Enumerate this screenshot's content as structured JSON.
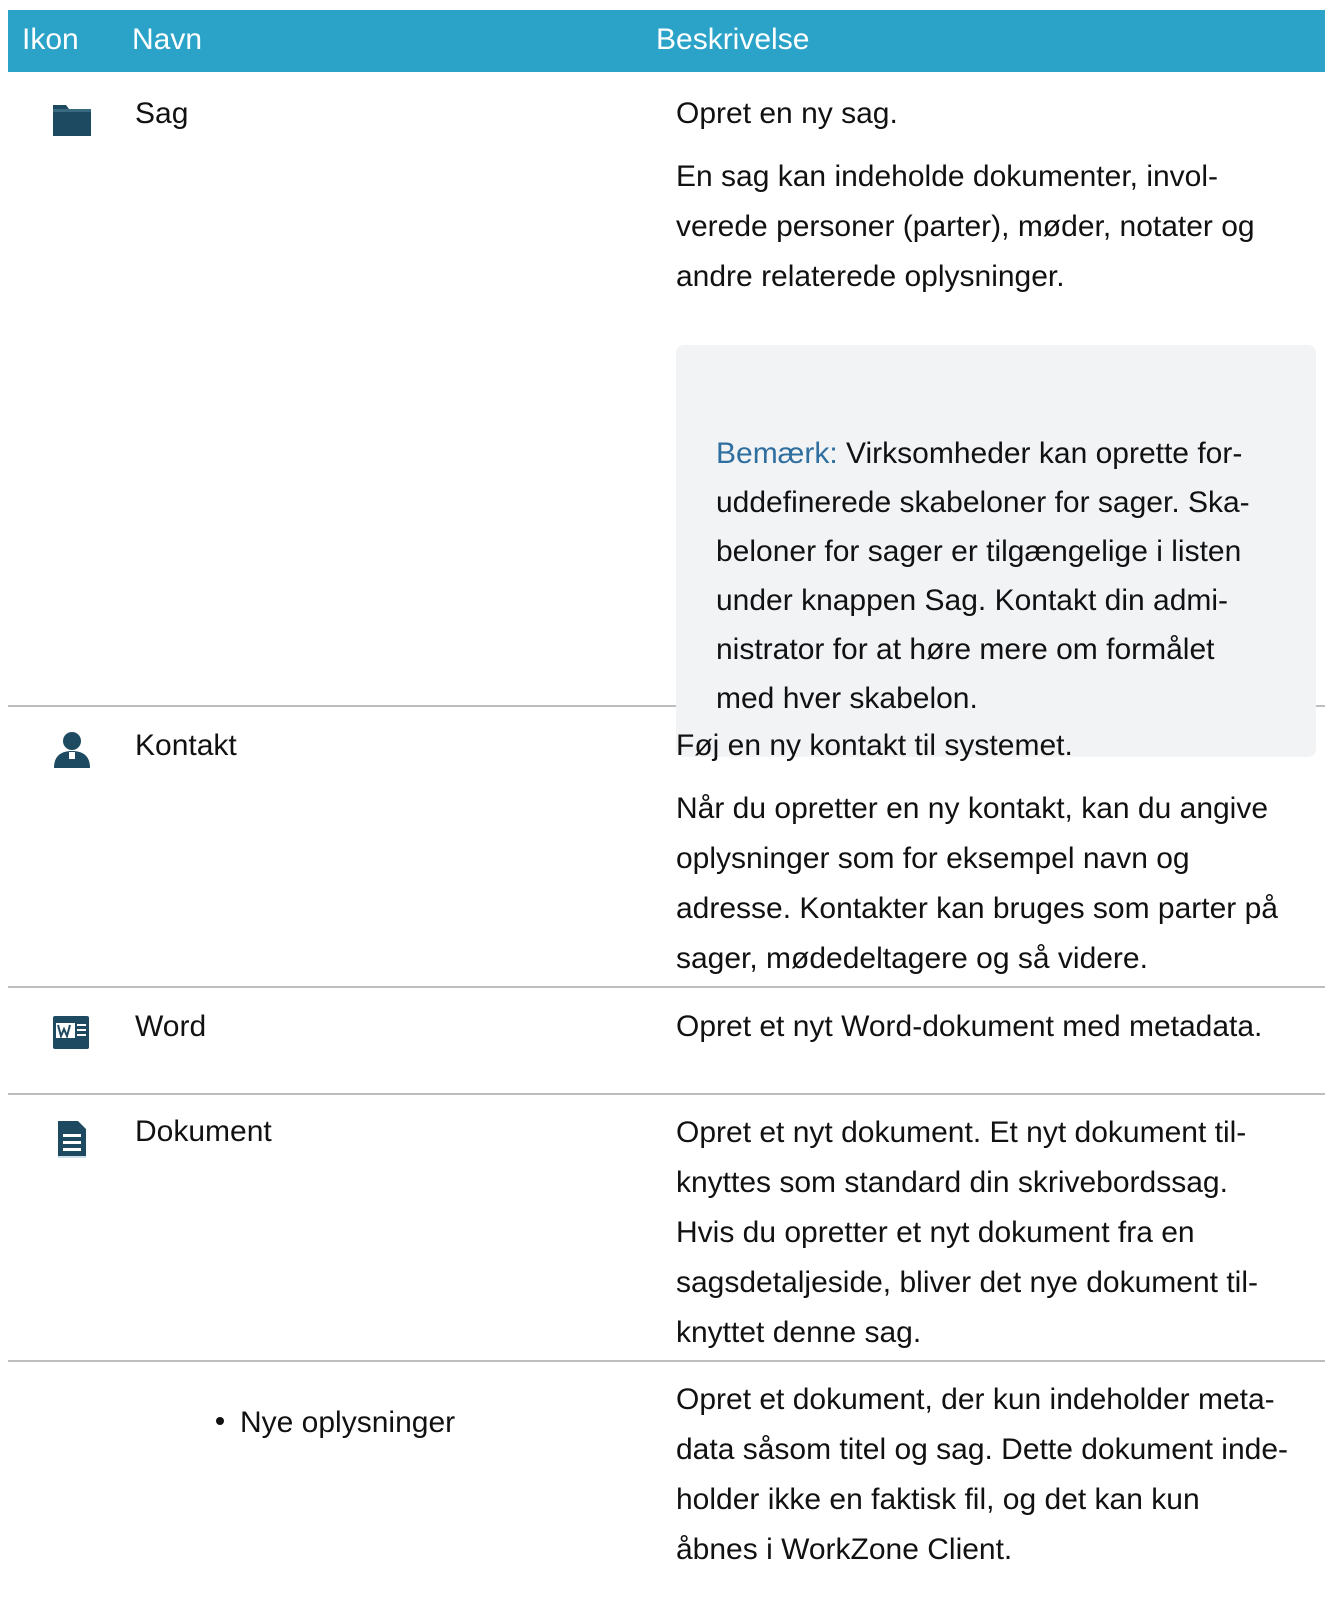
{
  "header": {
    "col_icon": "Ikon",
    "col_name": "Navn",
    "col_desc": "Beskrivelse"
  },
  "rows": [
    {
      "icon": "folder-icon",
      "name": "Sag",
      "desc": [
        "Opret en ny sag.",
        "En sag kan indeholde dokumenter, invol-\nverede personer (parter), møder, notater og\nandre relaterede oplysninger."
      ],
      "note": {
        "label": "Bemærk:",
        "text1": " Virksomheder kan oprette for-\nuddefinerede skabeloner for sager. Ska-\nbeloner for sager er tilgængelige i listen\nunder knappen ",
        "bold": "Sag",
        "text2": ". Kontakt din admi-\nnistrator for at høre mere om formålet\nmed hver skabelon."
      }
    },
    {
      "icon": "contact-icon",
      "name": "Kontakt",
      "desc": [
        "Føj en ny kontakt til systemet.",
        "Når du opretter en ny kontakt, kan du angive\noplysninger som for eksempel navn og\nadresse. Kontakter kan bruges som parter på\nsager, mødedeltagere og så videre."
      ]
    },
    {
      "icon": "word-icon",
      "name": "Word",
      "desc": [
        "Opret et nyt Word-dokument med metadata."
      ]
    },
    {
      "icon": "document-icon",
      "name": "Dokument",
      "desc": [
        "Opret et nyt dokument. Et nyt dokument til-\nknyttes som standard din skrivebordssag.\nHvis du opretter et nyt dokument fra en\nsagsdetaljeside, bliver det nye dokument til-\nknyttet denne sag."
      ]
    },
    {
      "name": "Nye oplysninger",
      "desc": [
        "Opret et dokument, der kun indeholder meta-\ndata såsom titel og sag. Dette dokument inde-\nholder ikke en faktisk fil, og det kan kun\nåbnes i WorkZone Client."
      ]
    }
  ],
  "colors": {
    "header_bg": "#2ba3c9",
    "icon": "#1d4a60",
    "note_bg": "#f2f3f5",
    "note_label": "#2f6f9f"
  }
}
